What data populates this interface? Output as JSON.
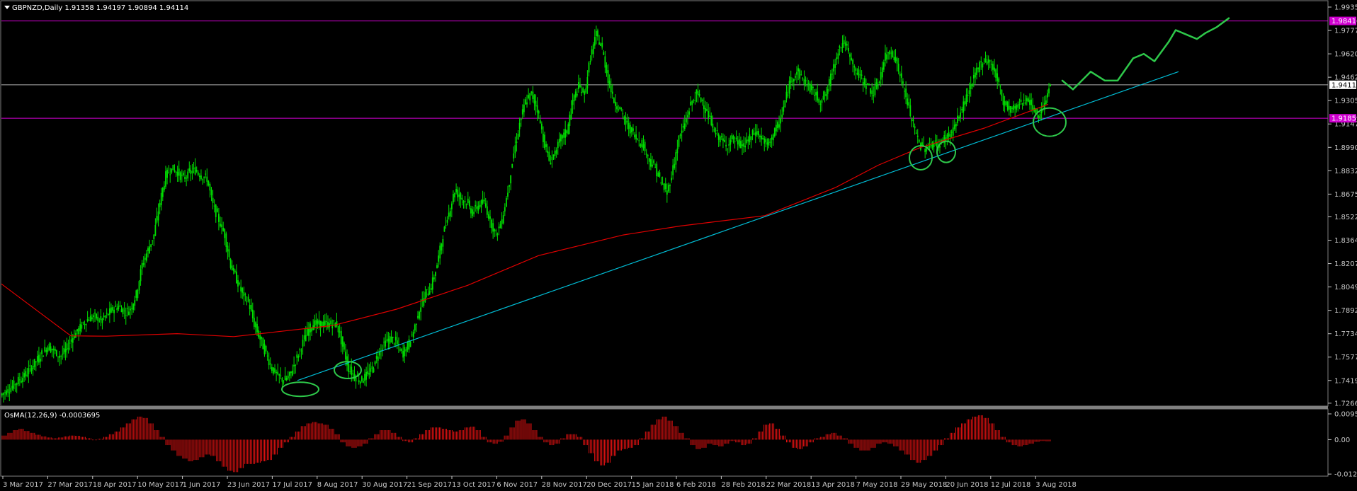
{
  "header": {
    "symbol_line": "GBPNZD,Daily  1.91358 1.94197 1.90894 1.94114"
  },
  "osma": {
    "label": "OsMA(12,26,9) -0.0003695"
  },
  "colors": {
    "background": "#000000",
    "candle": "#00e000",
    "ma": "#e00000",
    "trendline": "#00bcd4",
    "current_price_line": "#b0b0b0",
    "levels": "#d000d0",
    "annotation": "#2ec84a",
    "axis": "#c8c8c8",
    "histogram": "#dd1111"
  },
  "chart_data": [
    {
      "type": "line",
      "title": "GBPNZD,Daily",
      "ohlc_last": {
        "open": 1.91358,
        "high": 1.94197,
        "low": 1.90894,
        "close": 1.94114
      },
      "ylim": [
        1.7266,
        1.9935
      ],
      "y_ticks": [
        "1.99350",
        "1.97775",
        "1.96200",
        "1.94625",
        "1.93050",
        "1.91475",
        "1.89900",
        "1.88325",
        "1.86750",
        "1.85220",
        "1.83645",
        "1.82070",
        "1.80495",
        "1.78920",
        "1.77345",
        "1.75770",
        "1.74195",
        "1.72665"
      ],
      "x_ticks": [
        "3 Mar 2017",
        "27 Mar 2017",
        "18 Apr 2017",
        "10 May 2017",
        "1 Jun 2017",
        "23 Jun 2017",
        "17 Jul 2017",
        "8 Aug 2017",
        "30 Aug 2017",
        "21 Sep 2017",
        "13 Oct 2017",
        "6 Nov 2017",
        "28 Nov 2017",
        "20 Dec 2017",
        "15 Jan 2018",
        "6 Feb 2018",
        "28 Feb 2018",
        "22 Mar 2018",
        "13 Apr 2018",
        "7 May 2018",
        "29 May 2018",
        "20 Jun 2018",
        "12 Jul 2018",
        "3 Aug 2018"
      ],
      "price_closes": [
        1.735,
        1.738,
        1.742,
        1.745,
        1.75,
        1.755,
        1.76,
        1.765,
        1.762,
        1.758,
        1.762,
        1.77,
        1.775,
        1.78,
        1.784,
        1.785,
        1.782,
        1.786,
        1.79,
        1.792,
        1.788,
        1.79,
        1.8,
        1.82,
        1.83,
        1.84,
        1.862,
        1.88,
        1.885,
        1.882,
        1.878,
        1.882,
        1.884,
        1.88,
        1.878,
        1.86,
        1.85,
        1.84,
        1.82,
        1.81,
        1.8,
        1.795,
        1.78,
        1.77,
        1.76,
        1.75,
        1.745,
        1.742,
        1.745,
        1.755,
        1.765,
        1.775,
        1.78,
        1.78,
        1.78,
        1.78,
        1.78,
        1.765,
        1.75,
        1.745,
        1.742,
        1.745,
        1.75,
        1.76,
        1.767,
        1.77,
        1.768,
        1.76,
        1.765,
        1.775,
        1.79,
        1.8,
        1.805,
        1.82,
        1.84,
        1.855,
        1.87,
        1.865,
        1.862,
        1.855,
        1.86,
        1.862,
        1.85,
        1.84,
        1.85,
        1.87,
        1.895,
        1.915,
        1.93,
        1.935,
        1.925,
        1.905,
        1.89,
        1.895,
        1.905,
        1.91,
        1.93,
        1.94,
        1.935,
        1.96,
        1.975,
        1.965,
        1.945,
        1.93,
        1.925,
        1.915,
        1.91,
        1.905,
        1.9,
        1.89,
        1.885,
        1.875,
        1.868,
        1.885,
        1.905,
        1.915,
        1.928,
        1.935,
        1.93,
        1.92,
        1.91,
        1.905,
        1.9,
        1.905,
        1.902,
        1.9,
        1.905,
        1.91,
        1.905,
        1.9,
        1.908,
        1.915,
        1.93,
        1.945,
        1.95,
        1.945,
        1.94,
        1.935,
        1.93,
        1.935,
        1.95,
        1.965,
        1.97,
        1.96,
        1.95,
        1.945,
        1.94,
        1.935,
        1.945,
        1.96,
        1.965,
        1.955,
        1.94,
        1.925,
        1.91,
        1.9,
        1.898,
        1.902,
        1.9,
        1.905,
        1.908,
        1.915,
        1.925,
        1.935,
        1.945,
        1.955,
        1.958,
        1.955,
        1.945,
        1.93,
        1.925,
        1.925,
        1.93,
        1.932,
        1.925,
        1.92,
        1.93,
        1.941
      ],
      "sma": {
        "start": 1.807,
        "dip": 1.772,
        "mid_aug_2017": 1.779,
        "end": 1.928
      },
      "levels": [
        {
          "label": "1.98416",
          "value": 1.98416,
          "highlighted": true
        },
        {
          "label": "1.94114",
          "value": 1.94114,
          "highlighted": false
        },
        {
          "label": "1.91859",
          "value": 1.91859,
          "highlighted": true
        }
      ],
      "trendline": {
        "from": [
          "17 Jul 2017",
          1.74195
        ],
        "to": [
          "after 3 Aug 2018",
          1.95
        ]
      },
      "projection": "hand-drawn green path rising to ~1.99 after Aug 2018",
      "annotations": [
        "circle at Jul 2017 low",
        "circle at Aug 2017 low",
        "two circles at late May 2018 lows",
        "circle at early Aug 2018 low"
      ],
      "grid": false
    },
    {
      "type": "bar",
      "title": "OsMA(12,26,9) -0.0003695",
      "ylim": [
        -0.0127,
        0.009513
      ],
      "y_ticks": [
        "0.009513",
        "0.00",
        "-0.012725"
      ],
      "series": [
        {
          "values": [
            0.0015,
            0.0025,
            0.0035,
            0.004,
            0.0032,
            0.0025,
            0.0018,
            0.0012,
            0.0008,
            0.0005,
            0.0008,
            0.0012,
            0.0015,
            0.0014,
            0.001,
            0.0005,
            -0.0002,
            0.0003,
            0.001,
            0.002,
            0.003,
            0.0045,
            0.006,
            0.0075,
            0.0085,
            0.008,
            0.006,
            0.0035,
            0.001,
            -0.002,
            -0.004,
            -0.006,
            -0.007,
            -0.008,
            -0.0075,
            -0.0065,
            -0.0055,
            -0.006,
            -0.008,
            -0.01,
            -0.0115,
            -0.012,
            -0.0105,
            -0.009,
            -0.009,
            -0.0085,
            -0.008,
            -0.0075,
            -0.0055,
            -0.003,
            -0.001,
            0.001,
            0.003,
            0.005,
            0.006,
            0.0065,
            0.006,
            0.0055,
            0.004,
            0.002,
            -0.001,
            -0.0025,
            -0.003,
            -0.0025,
            -0.0015,
            0.0005,
            0.002,
            0.0035,
            0.0035,
            0.0025,
            0.001,
            -0.0005,
            -0.001,
            0.0005,
            0.002,
            0.0035,
            0.0045,
            0.0045,
            0.004,
            0.0035,
            0.003,
            0.0035,
            0.0045,
            0.0048,
            0.0035,
            0.001,
            -0.001,
            -0.0015,
            -0.0008,
            0.0015,
            0.0045,
            0.007,
            0.0075,
            0.006,
            0.0035,
            0.001,
            -0.001,
            -0.002,
            -0.0015,
            0.0005,
            0.002,
            0.002,
            0.001,
            -0.002,
            -0.005,
            -0.008,
            -0.0095,
            -0.0085,
            -0.006,
            -0.004,
            -0.0035,
            -0.003,
            -0.002,
            0.0005,
            0.003,
            0.0055,
            0.0075,
            0.0085,
            0.007,
            0.005,
            0.0025,
            0.0005,
            -0.002,
            -0.0035,
            -0.003,
            -0.0015,
            -0.002,
            -0.0025,
            -0.0015,
            -0.0005,
            -0.001,
            -0.002,
            -0.0015,
            0.0005,
            0.003,
            0.0055,
            0.006,
            0.004,
            0.0015,
            -0.001,
            -0.003,
            -0.0035,
            -0.0025,
            -0.001,
            0.0005,
            0.001,
            0.002,
            0.0025,
            0.0015,
            0.0005,
            -0.0015,
            -0.003,
            -0.004,
            -0.004,
            -0.003,
            -0.0015,
            -0.001,
            -0.0015,
            -0.0025,
            -0.004,
            -0.0055,
            -0.0075,
            -0.0085,
            -0.0075,
            -0.006,
            -0.004,
            -0.002,
            0.0005,
            0.0025,
            0.0045,
            0.006,
            0.0075,
            0.0085,
            0.009,
            0.008,
            0.006,
            0.0035,
            0.001,
            -0.001,
            -0.002,
            -0.0025,
            -0.002,
            -0.0015,
            -0.0008,
            -0.0005,
            -0.0006
          ]
        }
      ]
    }
  ]
}
